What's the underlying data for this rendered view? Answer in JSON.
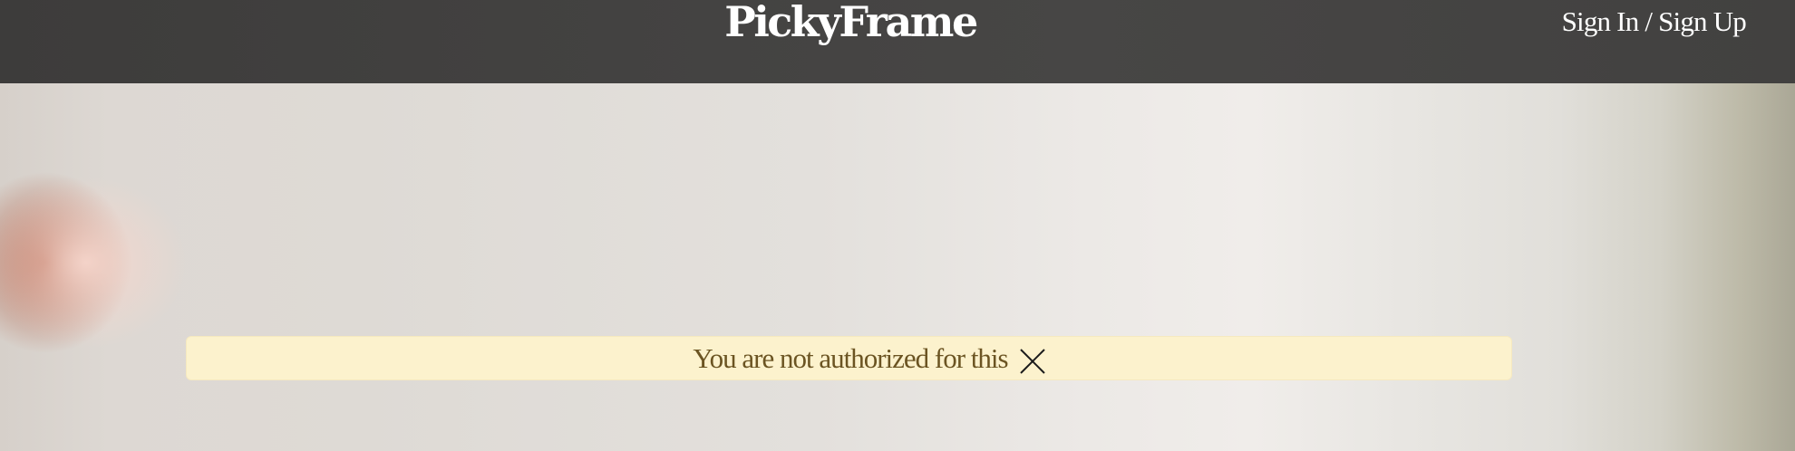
{
  "header": {
    "brand": "PickyFrame",
    "auth_link": "Sign In / Sign Up"
  },
  "alert": {
    "message": "You are not authorized for this",
    "close_icon": "close-icon"
  },
  "colors": {
    "header_bg": "#444342",
    "alert_bg": "#fcf2cd",
    "alert_text": "#6b5422"
  }
}
